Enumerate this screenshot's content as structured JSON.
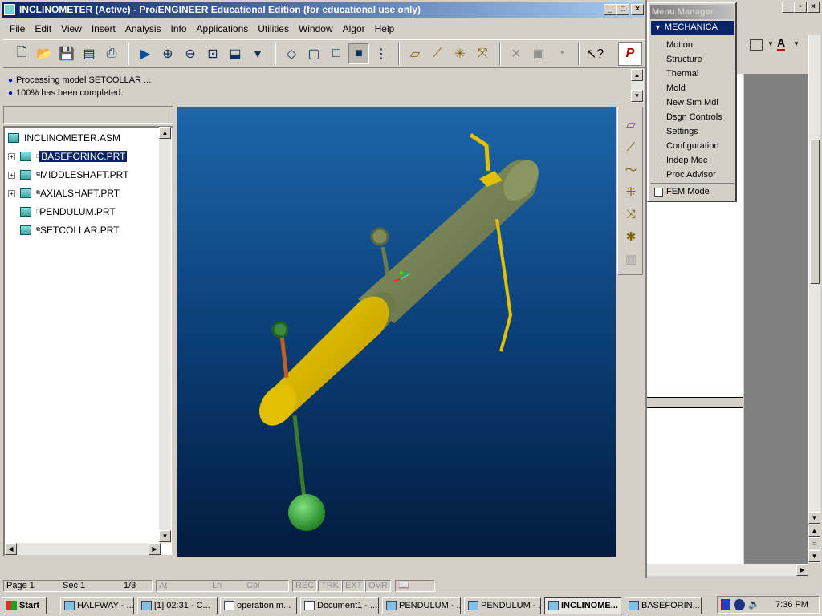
{
  "window": {
    "title": "INCLINOMETER (Active) - Pro/ENGINEER Educational Edition (for educational use only)"
  },
  "menubar": [
    "File",
    "Edit",
    "View",
    "Insert",
    "Analysis",
    "Info",
    "Applications",
    "Utilities",
    "Window",
    "Algor",
    "Help"
  ],
  "toolbar": {
    "icons": [
      "new-icon",
      "open-icon",
      "save-icon",
      "save-copy-icon",
      "print-icon",
      "repaint-icon",
      "zoom-in-icon",
      "zoom-out-icon",
      "refit-icon",
      "orient-icon",
      "saved-views-icon",
      "wireframe-icon",
      "hidden-line-icon",
      "no-hidden-icon",
      "shading-icon",
      "model-tree-icon",
      "datum-planes-icon",
      "datum-axes-icon",
      "datum-points-icon",
      "coord-sys-icon",
      "spin-center-icon",
      "orient-mode-icon",
      "context-help-icon",
      "ptc-logo-icon"
    ]
  },
  "messages": [
    "Processing model SETCOLLAR ...",
    "100% has been completed."
  ],
  "tree": {
    "root": "INCLINOMETER.ASM",
    "items": [
      {
        "label": "BASEFORINC.PRT",
        "expandable": true,
        "selected": true
      },
      {
        "label": "MIDDLESHAFT.PRT",
        "expandable": true,
        "selected": false
      },
      {
        "label": "AXIALSHAFT.PRT",
        "expandable": true,
        "selected": false
      },
      {
        "label": "PENDULUM.PRT",
        "expandable": false,
        "selected": false
      },
      {
        "label": "SETCOLLAR.PRT",
        "expandable": false,
        "selected": false
      }
    ]
  },
  "menu_manager": {
    "title": "Menu Manager",
    "header": "MECHANICA",
    "items": [
      "Motion",
      "Structure",
      "Thermal",
      "Mold",
      "New Sim Mdl",
      "Dsgn Controls",
      "Settings",
      "Configuration",
      "Indep Mec",
      "Proc Advisor"
    ],
    "checkbox_label": "FEM Mode"
  },
  "statusbar": {
    "page": "Page  1",
    "sec": "Sec  1",
    "pages": "1/3",
    "at": "At",
    "ln": "Ln",
    "col": "Col",
    "rec": "REC",
    "trk": "TRK",
    "ext": "EXT",
    "ovr": "OVR"
  },
  "taskbar": {
    "start": "Start",
    "tasks": [
      "HALFWAY - ...",
      "[1] 02:31 - C...",
      "operation m...",
      "Document1 - ...",
      "PENDULUM - ...",
      "PENDULUM - ...",
      "INCLINOME...",
      "BASEFORIN..."
    ],
    "clock": "7:36 PM"
  },
  "colors": {
    "viewport_top": "#1c66aa",
    "viewport_bottom": "#021b3e",
    "titlebar": "#0a246a",
    "shaft_yellow": "#e8c000",
    "shaft_olive": "#7e8c58",
    "pendulum_green": "#3aa23a"
  }
}
